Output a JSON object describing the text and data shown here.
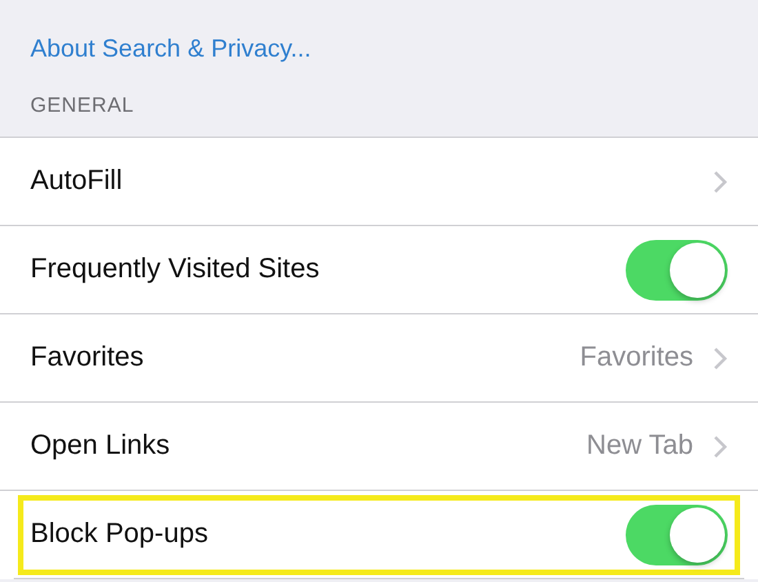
{
  "link": "About Search & Privacy...",
  "section_header": "GENERAL",
  "rows": [
    {
      "kind": "disclosure",
      "label": "AutoFill",
      "highlighted": false
    },
    {
      "kind": "toggle",
      "label": "Frequently Visited Sites",
      "on": true,
      "highlighted": false
    },
    {
      "kind": "disclosure",
      "label": "Favorites",
      "value": "Favorites",
      "highlighted": false
    },
    {
      "kind": "disclosure",
      "label": "Open Links",
      "value": "New Tab",
      "highlighted": false
    },
    {
      "kind": "toggle",
      "label": "Block Pop-ups",
      "on": true,
      "highlighted": true
    }
  ]
}
